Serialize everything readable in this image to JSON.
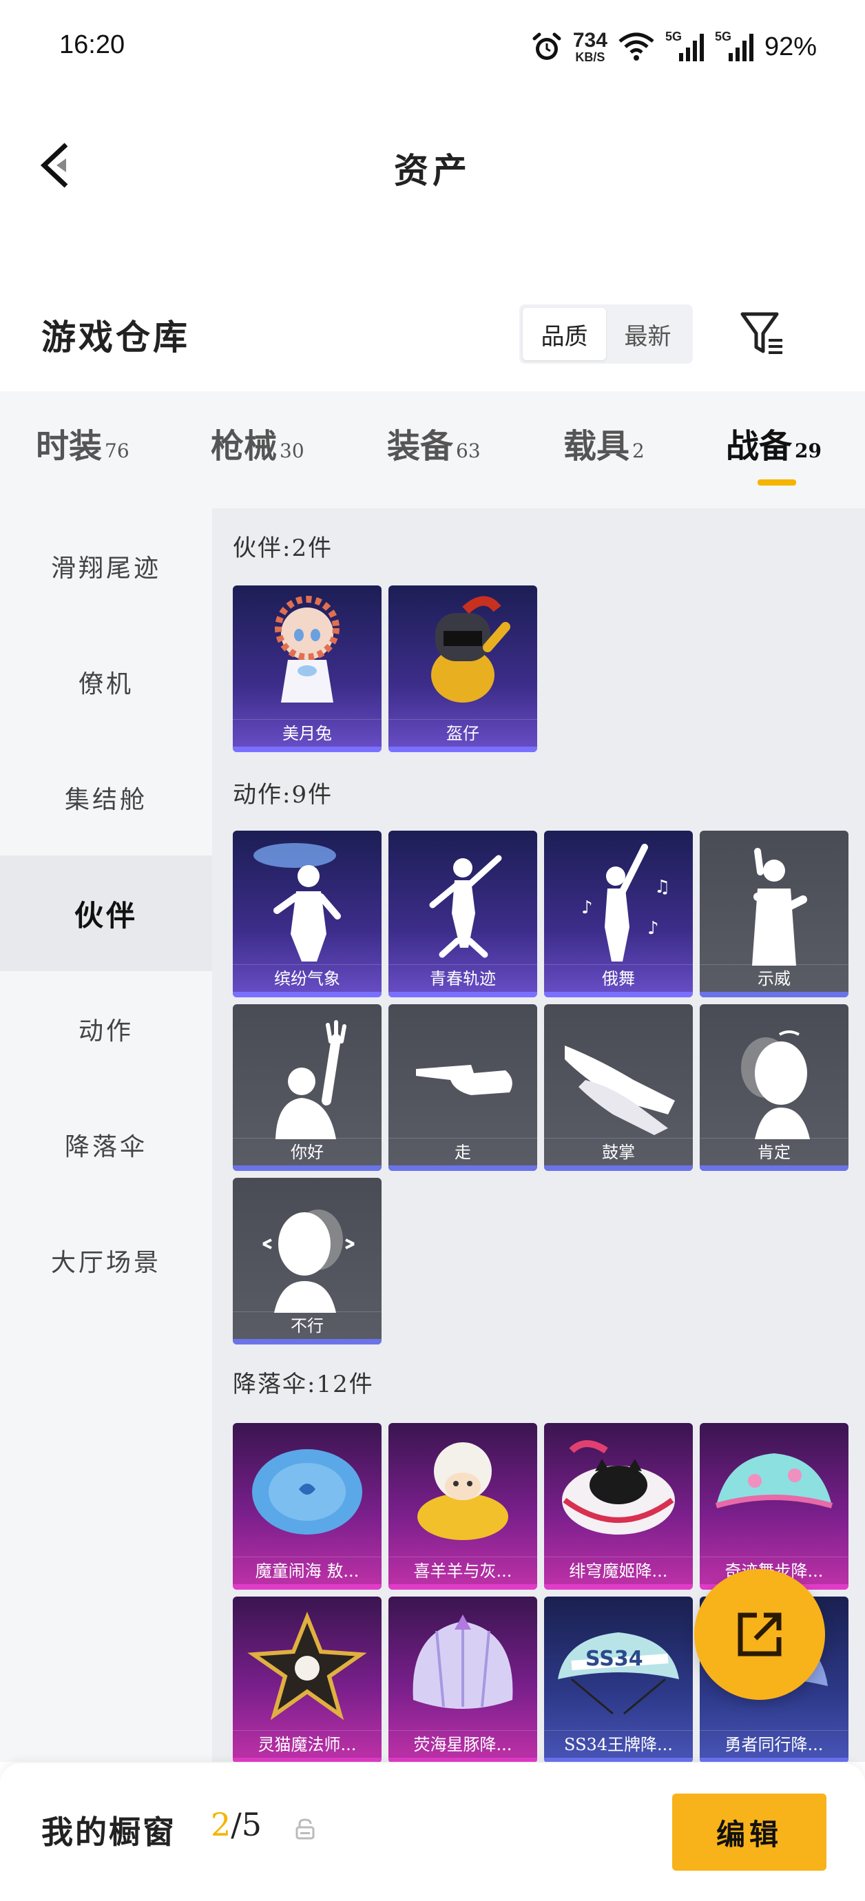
{
  "status": {
    "time": "16:20",
    "net_speed": "734",
    "net_unit": "KB/S",
    "sig1": "5G",
    "sig2": "5G",
    "battery": "92%"
  },
  "header": {
    "title": "资产"
  },
  "section": {
    "title": "游戏仓库",
    "sort_quality": "品质",
    "sort_latest": "最新"
  },
  "tabs": [
    {
      "label": "时装",
      "count": "76"
    },
    {
      "label": "枪械",
      "count": "30"
    },
    {
      "label": "装备",
      "count": "63"
    },
    {
      "label": "载具",
      "count": "2"
    },
    {
      "label": "战备",
      "count": "29"
    }
  ],
  "sidebar": {
    "items": [
      "滑翔尾迹",
      "僚机",
      "集结舱",
      "伙伴",
      "动作",
      "降落伞",
      "大厅场景"
    ]
  },
  "groups": {
    "partners": {
      "title": "伙伴:2件",
      "items": [
        "美月兔",
        "盔仔"
      ]
    },
    "actions": {
      "title": "动作:9件",
      "items": [
        "缤纷气象",
        "青春轨迹",
        "俄舞",
        "示威",
        "你好",
        "走",
        "鼓掌",
        "肯定",
        "不行"
      ]
    },
    "parachutes": {
      "title": "降落伞:12件",
      "items": [
        "魔童闹海 敖...",
        "喜羊羊与灰...",
        "绯穹魔姬降...",
        "奇迹舞步降...",
        "灵猫魔法师...",
        "荧海星豚降...",
        "SS34王牌降...",
        "勇者同行降..."
      ]
    }
  },
  "bottom": {
    "title": "我的橱窗",
    "current": "2",
    "total": "/5",
    "edit": "编辑"
  },
  "colors": {
    "accent": "#f8b21a"
  }
}
